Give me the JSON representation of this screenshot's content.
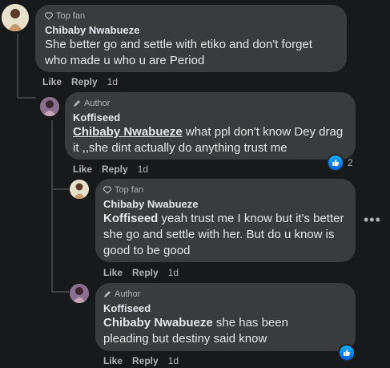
{
  "comments": [
    {
      "badge": "Top fan",
      "author": "Chibaby Nwabueze",
      "text": "She better go and settle with etiko and don't forget who made u who u are Period",
      "actions": {
        "like": "Like",
        "reply": "Reply",
        "time": "1d"
      }
    },
    {
      "badge": "Author",
      "author": "Koffiseed",
      "mention": "Chibaby Nwabueze",
      "text": " what ppl don't know Dey drag it ,,she dint actually do anything trust me",
      "actions": {
        "like": "Like",
        "reply": "Reply",
        "time": "1d"
      },
      "reaction_count": "2"
    },
    {
      "badge": "Top fan",
      "author": "Chibaby Nwabueze",
      "mention": "Koffiseed",
      "text": " yeah trust me I know but it's better she go and settle with her. But do u know is good to be good",
      "actions": {
        "like": "Like",
        "reply": "Reply",
        "time": "1d"
      }
    },
    {
      "badge": "Author",
      "author": "Koffiseed",
      "mention": "Chibaby Nwabueze",
      "text": " she has been pleading but destiny said know",
      "actions": {
        "like": "Like",
        "reply": "Reply",
        "time": "1d"
      }
    }
  ],
  "more_icon": "more-horizontal-icon",
  "colors": {
    "background": "#18191a",
    "bubble": "#3a3b3c",
    "like_blue": "#1877f2"
  }
}
